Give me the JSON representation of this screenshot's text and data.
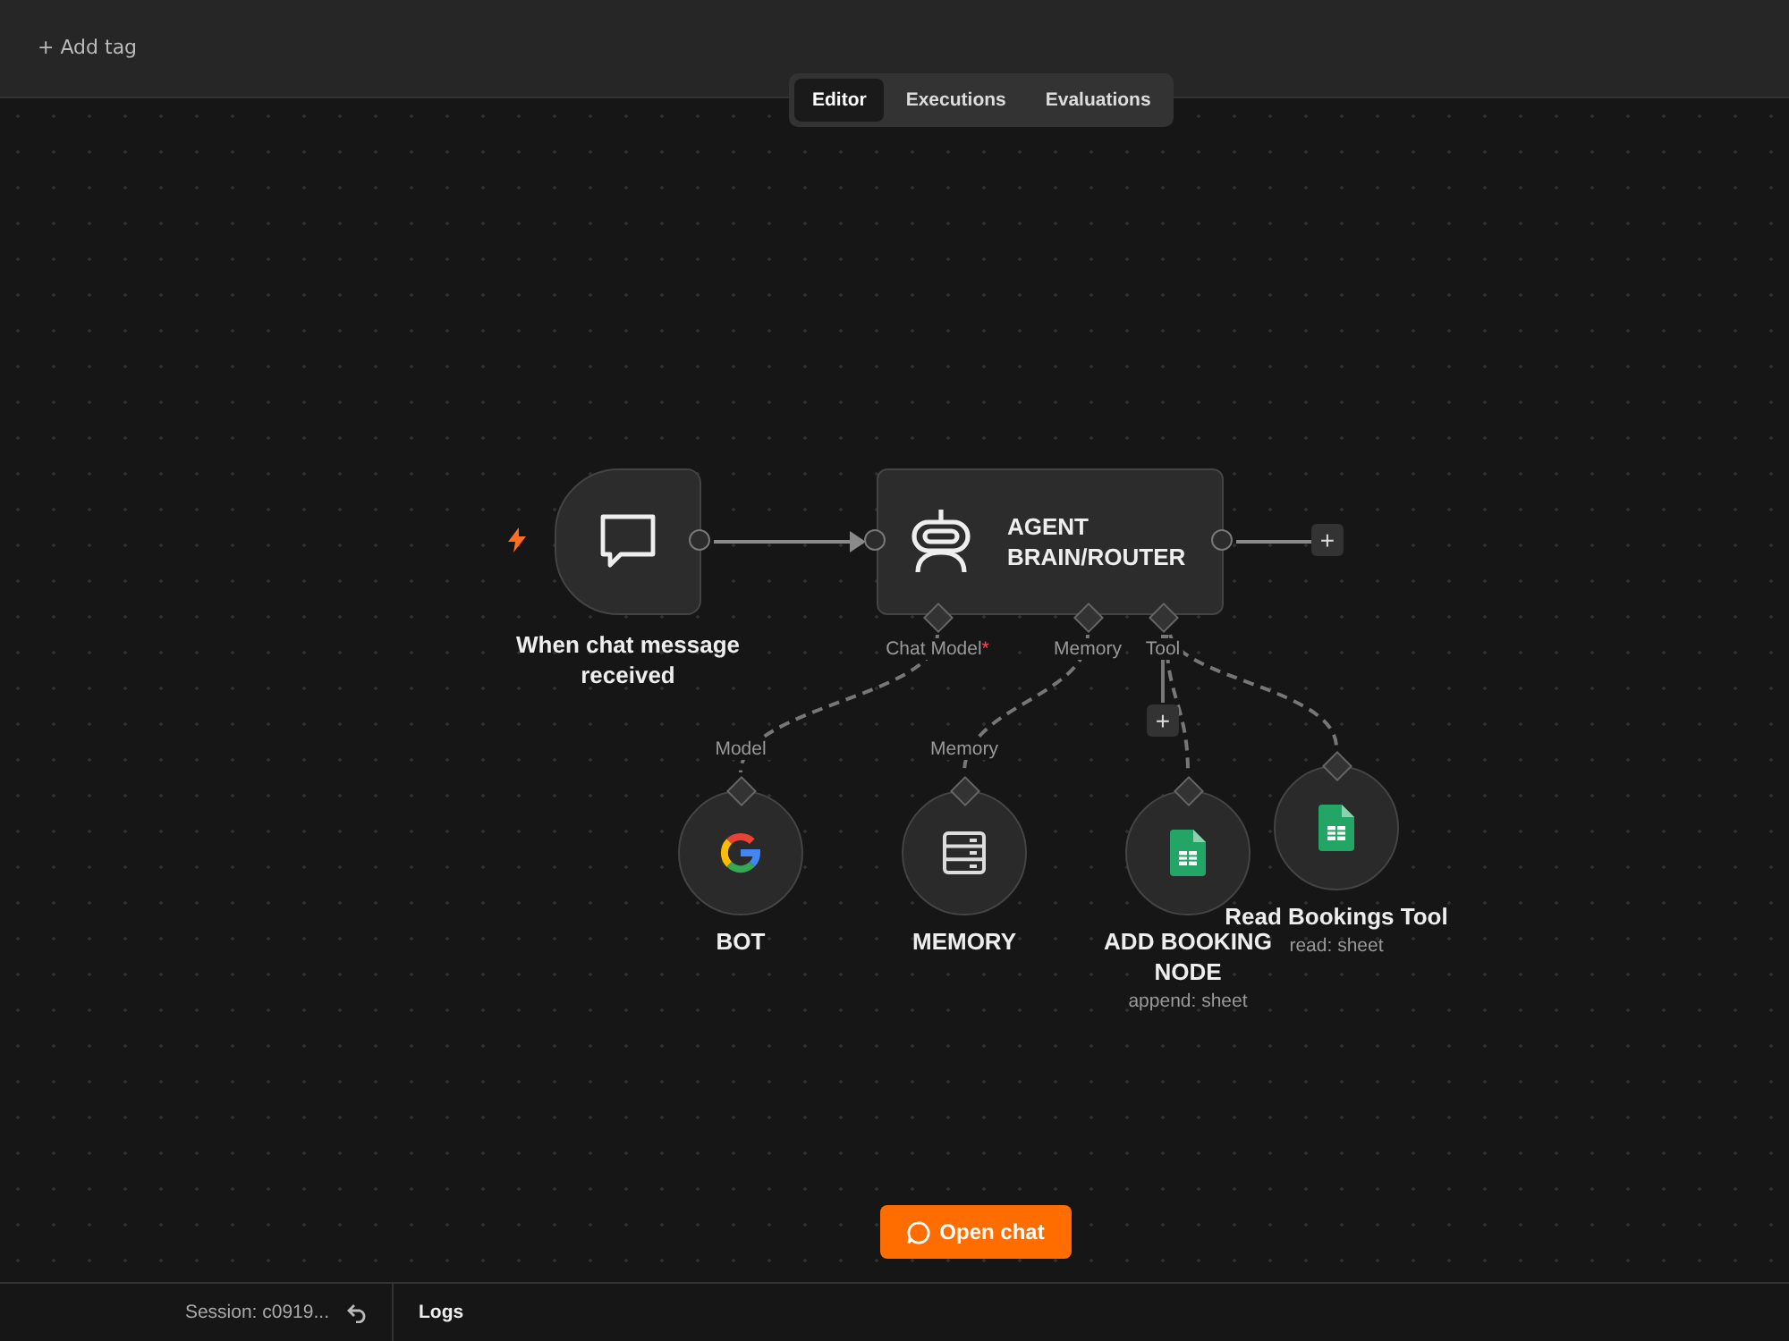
{
  "header": {
    "add_tag": "+ Add tag"
  },
  "tabs": [
    {
      "label": "Editor",
      "selected": true
    },
    {
      "label": "Executions",
      "selected": false
    },
    {
      "label": "Evaluations",
      "selected": false
    }
  ],
  "trigger": {
    "label": "When chat message received"
  },
  "agent": {
    "title": "AGENT BRAIN/ROUTER",
    "add": "+"
  },
  "ports": [
    {
      "label": "Chat Model",
      "required_mark": "*"
    },
    {
      "label": "Memory"
    },
    {
      "label": "Tool",
      "add": "+"
    }
  ],
  "sub_nodes": [
    {
      "kind": "google",
      "label": "BOT",
      "port_label": "Model"
    },
    {
      "kind": "memory",
      "label": "MEMORY",
      "port_label": "Memory"
    },
    {
      "kind": "sheet",
      "label": "ADD BOOKING NODE",
      "subtitle": "append: sheet"
    },
    {
      "kind": "sheet",
      "label": "Read Bookings Tool",
      "subtitle": "read: sheet"
    }
  ],
  "open_chat": "Open chat",
  "bottom_bar": {
    "session": "Session: c0919...",
    "logs": "Logs"
  }
}
